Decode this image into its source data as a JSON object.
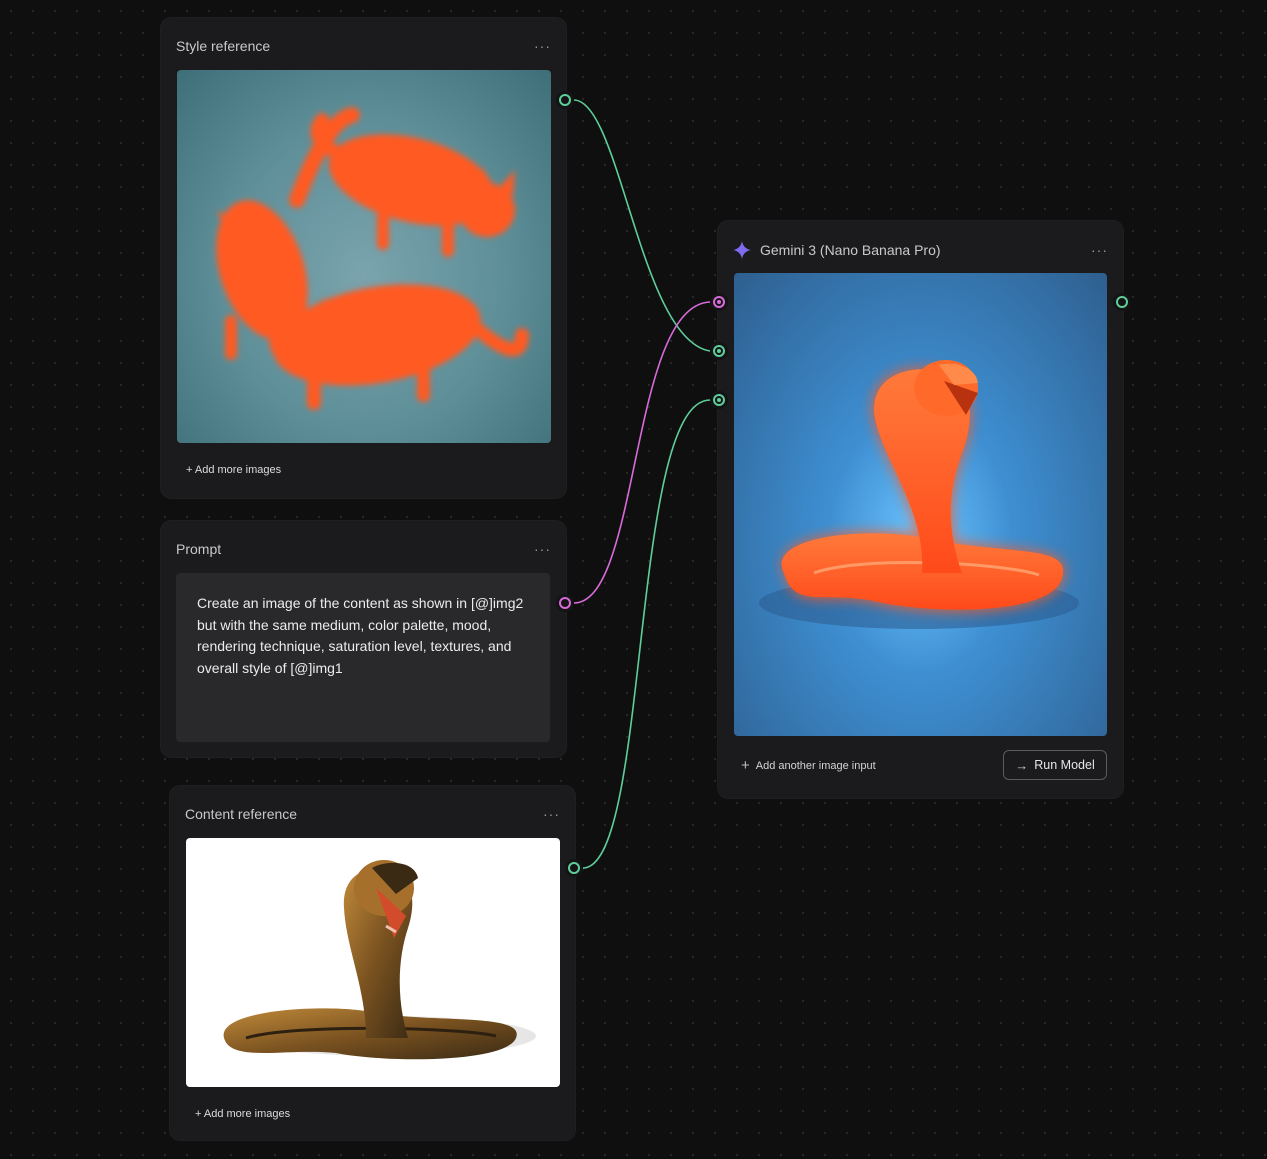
{
  "nodes": {
    "style_reference": {
      "title": "Style reference",
      "menu_label": "···",
      "add_more_label": "+ Add more images"
    },
    "prompt": {
      "title": "Prompt",
      "menu_label": "···",
      "text": "Create an image of the content as shown in [@]img2 but with the same medium, color palette, mood, rendering technique, saturation level, textures, and overall style of [@]img1"
    },
    "content_reference": {
      "title": "Content reference",
      "menu_label": "···",
      "add_more_label": "+ Add more images"
    },
    "model": {
      "title": "Gemini 3 (Nano Banana Pro)",
      "menu_label": "···",
      "add_input_label": "Add another image input",
      "run_label": "Run Model"
    }
  },
  "colors": {
    "background": "#0f0f10",
    "node": "#1b1b1d",
    "image_port": "#5ecf9a",
    "text_port": "#d86bd9",
    "gemini_icon": "#7d6cf2"
  },
  "icons": {
    "model_icon": "gemini-sparkle-icon",
    "run_icon": "arrow-right-icon",
    "add_icon": "plus-icon",
    "menu_icon": "more-horizontal-icon"
  }
}
